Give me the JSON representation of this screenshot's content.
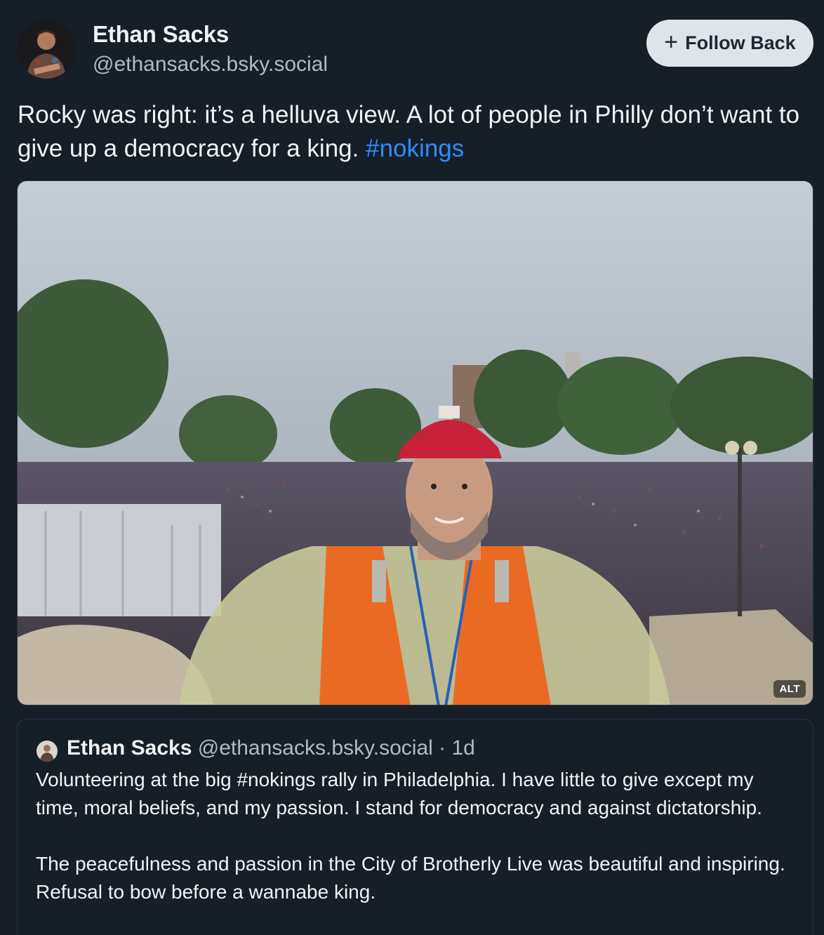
{
  "author": {
    "name": "Ethan Sacks",
    "handle": "@ethansacks.bsky.social",
    "avatar_icon": "profile-photo"
  },
  "follow_button": {
    "icon": "plus-icon",
    "label": "Follow Back"
  },
  "post": {
    "text": "Rocky was right: it’s a helluva view. A lot of people in Philly don’t want to give up a democracy for a king.",
    "hashtag": "#nokings"
  },
  "media": {
    "alt_badge": "ALT"
  },
  "quoted_post": {
    "name": "Ethan Sacks",
    "handle": "@ethansacks.bsky.social",
    "separator": "·",
    "time": "1d",
    "paragraphs": [
      "Volunteering at the big #nokings rally in Philadelphia. I have little to give except my time, moral beliefs, and my passion. I stand for democracy and against dictatorship.",
      "The peacefulness and passion in the City of Brotherly Live was beautiful and inspiring. Refusal to bow before a wannabe king."
    ]
  },
  "colors": {
    "background": "#161e27",
    "text": "#f1f3f5",
    "muted": "#aebbc9",
    "link": "#2f8bff",
    "button_bg": "#dfe4ea",
    "border": "#2b3744"
  }
}
